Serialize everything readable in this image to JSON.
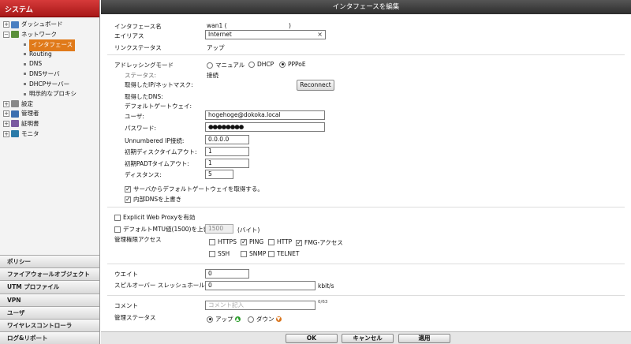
{
  "sidebar": {
    "header": "システム",
    "tree": [
      {
        "label": "ダッシュボード",
        "exp": "+",
        "icon": "dashboard-icon"
      },
      {
        "label": "ネットワーク",
        "exp": "−",
        "icon": "network-icon"
      },
      {
        "label": "インタフェース",
        "child": true,
        "selected": true
      },
      {
        "label": "Routing",
        "child": true
      },
      {
        "label": "DNS",
        "child": true
      },
      {
        "label": "DNSサーバ",
        "child": true
      },
      {
        "label": "DHCPサーバー",
        "child": true
      },
      {
        "label": "明示的なプロキシ",
        "child": true
      },
      {
        "label": "設定",
        "exp": "+",
        "icon": "settings-icon"
      },
      {
        "label": "管理者",
        "exp": "+",
        "icon": "admin-icon"
      },
      {
        "label": "証明書",
        "exp": "+",
        "icon": "certificate-icon"
      },
      {
        "label": "モニタ",
        "exp": "+",
        "icon": "monitor-icon"
      }
    ],
    "bottom_menu": [
      "ポリシー",
      "ファイアウォールオブジェクト",
      "UTM プロファイル",
      "VPN",
      "ユーザ",
      "ワイヤレスコントローラ",
      "ログ&リポート"
    ]
  },
  "main": {
    "title": "インタフェースを編集",
    "interface_name_label": "インタフェース名",
    "interface_name_value": "wan1 (",
    "interface_name_close": ")",
    "alias_label": "エイリアス",
    "alias_value": "Internet",
    "link_status_label": "リンクステータス",
    "link_status_value": "アップ",
    "addressing_mode_label": "アドレッシングモード",
    "addressing_options": [
      "マニュアル",
      "DHCP",
      "PPPoE"
    ],
    "addressing_selected": "PPPoE",
    "status_label": "ステータス:",
    "status_value": "接続",
    "ip_mask_label": "取得したIP/ネットマスク:",
    "reconnect_label": "Reconnect",
    "dns_label": "取得したDNS:",
    "gateway_label": "デフォルトゲートウェイ:",
    "user_label": "ユーザ:",
    "user_value": "hogehoge@dokoka.local",
    "password_label": "パスワード:",
    "password_value": "●●●●●●●●",
    "unnumbered_label": "Unnumbered IP接続:",
    "unnumbered_value": "0.0.0.0",
    "discovery_timeout_label": "初期ディスクタイムアウト:",
    "discovery_timeout_value": "1",
    "padt_timeout_label": "初期PADTタイムアウト:",
    "padt_timeout_value": "1",
    "distance_label": "ディスタンス:",
    "distance_value": "5",
    "get_gateway_label": "サーバからデフォルトゲートウェイを取得する。",
    "override_dns_label": "内部DNSを上書き",
    "explicit_proxy_label": "Explicit Web Proxyを有効",
    "mtu_label": "デフォルトMTU値(1500)を上書き",
    "mtu_value": "1500",
    "mtu_unit": "(バイト)",
    "admin_access_label": "管理権限アクセス",
    "access_options": [
      {
        "label": "HTTPS",
        "checked": false
      },
      {
        "label": "PING",
        "checked": true
      },
      {
        "label": "HTTP",
        "checked": false
      },
      {
        "label": "FMG-アクセス",
        "checked": true
      },
      {
        "label": "SSH",
        "checked": false
      },
      {
        "label": "SNMP",
        "checked": false
      },
      {
        "label": "TELNET",
        "checked": false
      }
    ],
    "weight_label": "ウエイト",
    "weight_value": "0",
    "spillover_label": "スピルオーバー スレッシュホールド",
    "spillover_value": "0",
    "spillover_unit": "kbit/s",
    "comment_label": "コメント",
    "comment_placeholder": "コメント記入",
    "comment_counter": "0/63",
    "admin_status_label": "管理ステータス",
    "admin_status_up": "アップ",
    "admin_status_down": "ダウン"
  },
  "footer": {
    "ok": "OK",
    "cancel": "キャンセル",
    "apply": "適用"
  },
  "colors": {
    "sidebar_header": "#c02828",
    "selected_item": "#e07a1a",
    "titlebar": "#3a3a3a"
  }
}
